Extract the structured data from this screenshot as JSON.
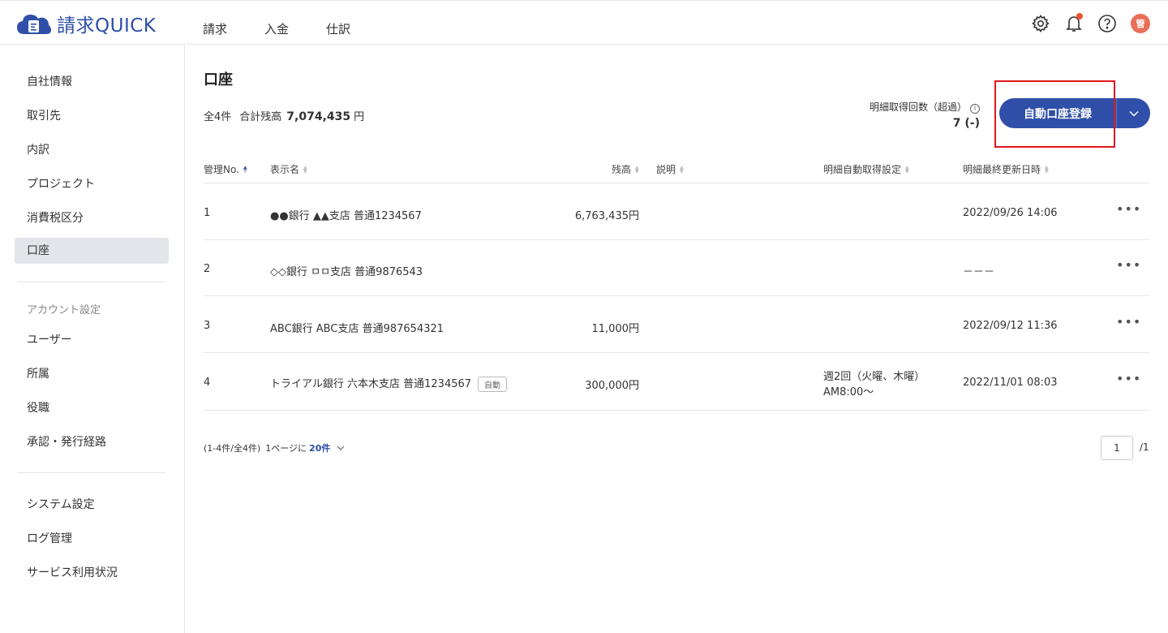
{
  "app": {
    "logo_text": "請求QUICK",
    "brand_color": "#2f4fa8",
    "accent_red": "#e0181c"
  },
  "topnav": [
    "請求",
    "入金",
    "仕訳"
  ],
  "header_icons": [
    "gear-icon",
    "bell-icon",
    "help-icon",
    "avatar"
  ],
  "avatar_text": "管",
  "sidebar": {
    "items": [
      "自社情報",
      "取引先",
      "内訳",
      "プロジェクト",
      "消費税区分",
      "口座"
    ],
    "active": "口座",
    "account_section": "アカウント設定",
    "account_items": [
      "ユーザー",
      "所属",
      "役職",
      "承認・発行経路"
    ],
    "system_items": [
      "システム設定",
      "ログ管理",
      "サービス利用状況"
    ]
  },
  "main": {
    "title": "口座",
    "count_label": "全4件",
    "total_label": "合計残高",
    "total_value": "7,074,435",
    "total_unit": "円",
    "fetch_label": "明細取得回数（超過）",
    "fetch_value": "7 (-)",
    "register_button": "自動口座登録"
  },
  "table": {
    "headers": {
      "no": "管理No.",
      "name": "表示名",
      "balance": "残高",
      "desc": "説明",
      "auto": "明細自動取得設定",
      "updated": "明細最終更新日時"
    },
    "rows": [
      {
        "no": "1",
        "name": "●●銀行 ▲▲支店 普通1234567",
        "tag": "",
        "balance": "6,763,435円",
        "auto1": "",
        "auto2": "",
        "updated": "2022/09/26 14:06"
      },
      {
        "no": "2",
        "name": "◇◇銀行 ㅁㅁ支店 普通9876543",
        "tag": "",
        "balance": "",
        "auto1": "",
        "auto2": "",
        "updated": "－－－"
      },
      {
        "no": "3",
        "name": "ABC銀行 ABC支店 普通987654321",
        "tag": "",
        "balance": "11,000円",
        "auto1": "",
        "auto2": "",
        "updated": "2022/09/12 11:36"
      },
      {
        "no": "4",
        "name": "トライアル銀行 六本木支店 普通1234567",
        "tag": "自動",
        "balance": "300,000円",
        "auto1": "週2回（火曜、木曜）",
        "auto2": "AM8:00〜",
        "updated": "2022/11/01 08:03"
      }
    ]
  },
  "pagination": {
    "range": "(1-4件/全4件)",
    "per_page_label": "1ページに",
    "per_page_value": "20件",
    "current_page": "1",
    "total_pages": "/1"
  }
}
